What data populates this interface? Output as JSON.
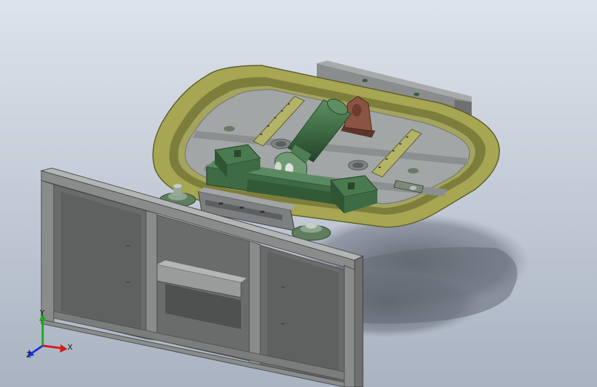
{
  "viewport": {
    "background_top": "#dde3ec",
    "background_bottom": "#a9b3c1"
  },
  "triad": {
    "x_label": "X",
    "y_label": "Y",
    "z_label": "Z",
    "x_color": "#d11b1b",
    "y_color": "#1fa51f",
    "z_color": "#1f2fd8"
  },
  "colors": {
    "frame_gray": "#8d8f8f",
    "frame_dark": "#5b5d5d",
    "ring_olive": "#a6a653",
    "ring_dark": "#6f6f32",
    "plate_gray": "#9ea2a2",
    "part_green": "#3e6b43",
    "part_green_dark": "#284a2d",
    "bracket_brown": "#7a4a38",
    "shadow": "#6f7480"
  }
}
